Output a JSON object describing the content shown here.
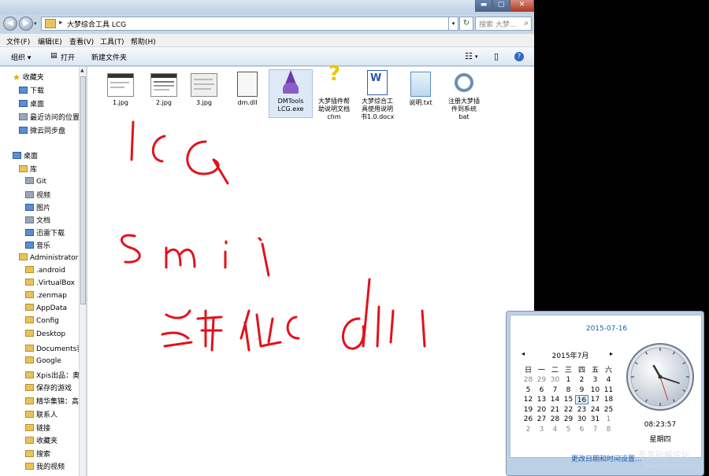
{
  "window": {
    "caption_buttons": {
      "minimize": "▬",
      "maximize": "▢",
      "close": "✕"
    },
    "nav_drop": "▾"
  },
  "address": {
    "separator": "▸",
    "path": "大梦综合工具 LCG",
    "dropdown": "▾",
    "refresh": "↻"
  },
  "search": {
    "placeholder": "搜索 大梦..."
  },
  "menu": {
    "file": "文件(F)",
    "edit": "编辑(E)",
    "view": "查看(V)",
    "tools": "工具(T)",
    "help": "帮助(H)"
  },
  "toolbar": {
    "organize": "组织 ▾",
    "open": "打开",
    "new_folder": "新建文件夹"
  },
  "nav": {
    "favorites": "收藏夹",
    "downloads": "下载",
    "desktop_fav": "桌面",
    "recent": "最近访问的位置",
    "cloud": "微云同步盘",
    "desktop": "桌面",
    "libraries": "库",
    "git": "Git",
    "videos": "视频",
    "pictures": "图片",
    "documents": "文档",
    "thunder": "迅雷下载",
    "music": "音乐",
    "admin": "Administrator",
    "android": ".android",
    "virtualbox": ".VirtualBox",
    "zenmap": ".zenmap",
    "appdata": "AppData",
    "config": "Config",
    "desktop2": "Desktop",
    "documents2": "Documents我",
    "google": "Google",
    "xpis": "Xpis出品：奥",
    "games": "保存的游戏",
    "collection": "精华集锦：高",
    "contacts": "联系人",
    "links": "链接",
    "favs2": "收藏夹",
    "searches": "搜索",
    "myvideos": "我的视频"
  },
  "files": [
    {
      "name": "1.jpg",
      "type": "image"
    },
    {
      "name": "2.jpg",
      "type": "image"
    },
    {
      "name": "3.jpg",
      "type": "image"
    },
    {
      "name": "dm.dll",
      "type": "dll"
    },
    {
      "name": "DMTools LCG.exe",
      "type": "exe"
    },
    {
      "name": "大梦插件帮助说明文档.chm",
      "type": "chm"
    },
    {
      "name": "大梦综合工具使用说明书1.0.docx",
      "type": "docx"
    },
    {
      "name": "说明.txt",
      "type": "txt"
    },
    {
      "name": "注册大梦插件到系统.bat",
      "type": "bat"
    }
  ],
  "file_labels": {
    "f1": "1.jpg",
    "f2": "2.jpg",
    "f3": "3.jpg",
    "f4": "dm.dll",
    "f5a": "DMTools",
    "f5b": "LCG.exe",
    "f6a": "大梦插件帮",
    "f6b": "助说明文档",
    "f6c": "chm",
    "f7a": "大梦综合工",
    "f7b": "具使用说明",
    "f7c": "书1.0.docx",
    "f8": "说明.txt",
    "f9a": "注册大梦插",
    "f9b": "件到系统",
    "f9c": "bat"
  },
  "handwriting": "lcG smii 绑化 dll",
  "calendar": {
    "long_date": "2015-07-16",
    "month_title": "2015年7月",
    "prev": "◂",
    "next": "▸",
    "weekdays": [
      "日",
      "一",
      "二",
      "三",
      "四",
      "五",
      "六"
    ],
    "days": [
      [
        "28",
        "29",
        "30",
        "1",
        "2",
        "3",
        "4"
      ],
      [
        "5",
        "6",
        "7",
        "8",
        "9",
        "10",
        "11"
      ],
      [
        "12",
        "13",
        "14",
        "15",
        "16",
        "17",
        "18"
      ],
      [
        "19",
        "20",
        "21",
        "22",
        "23",
        "24",
        "25"
      ],
      [
        "26",
        "27",
        "28",
        "29",
        "30",
        "31",
        "1"
      ],
      [
        "2",
        "3",
        "4",
        "5",
        "6",
        "7",
        "8"
      ]
    ],
    "today": "16",
    "time": "08:23:57",
    "weekday": "星期四",
    "change_link": "更改日期和时间设置..."
  },
  "watermark": "吾爱破解论坛",
  "watermark2": "www.52pojie.cn",
  "colors": {
    "accent": "#1c5fb0",
    "ink": "#e1121b",
    "selection": "#dde9f7"
  }
}
